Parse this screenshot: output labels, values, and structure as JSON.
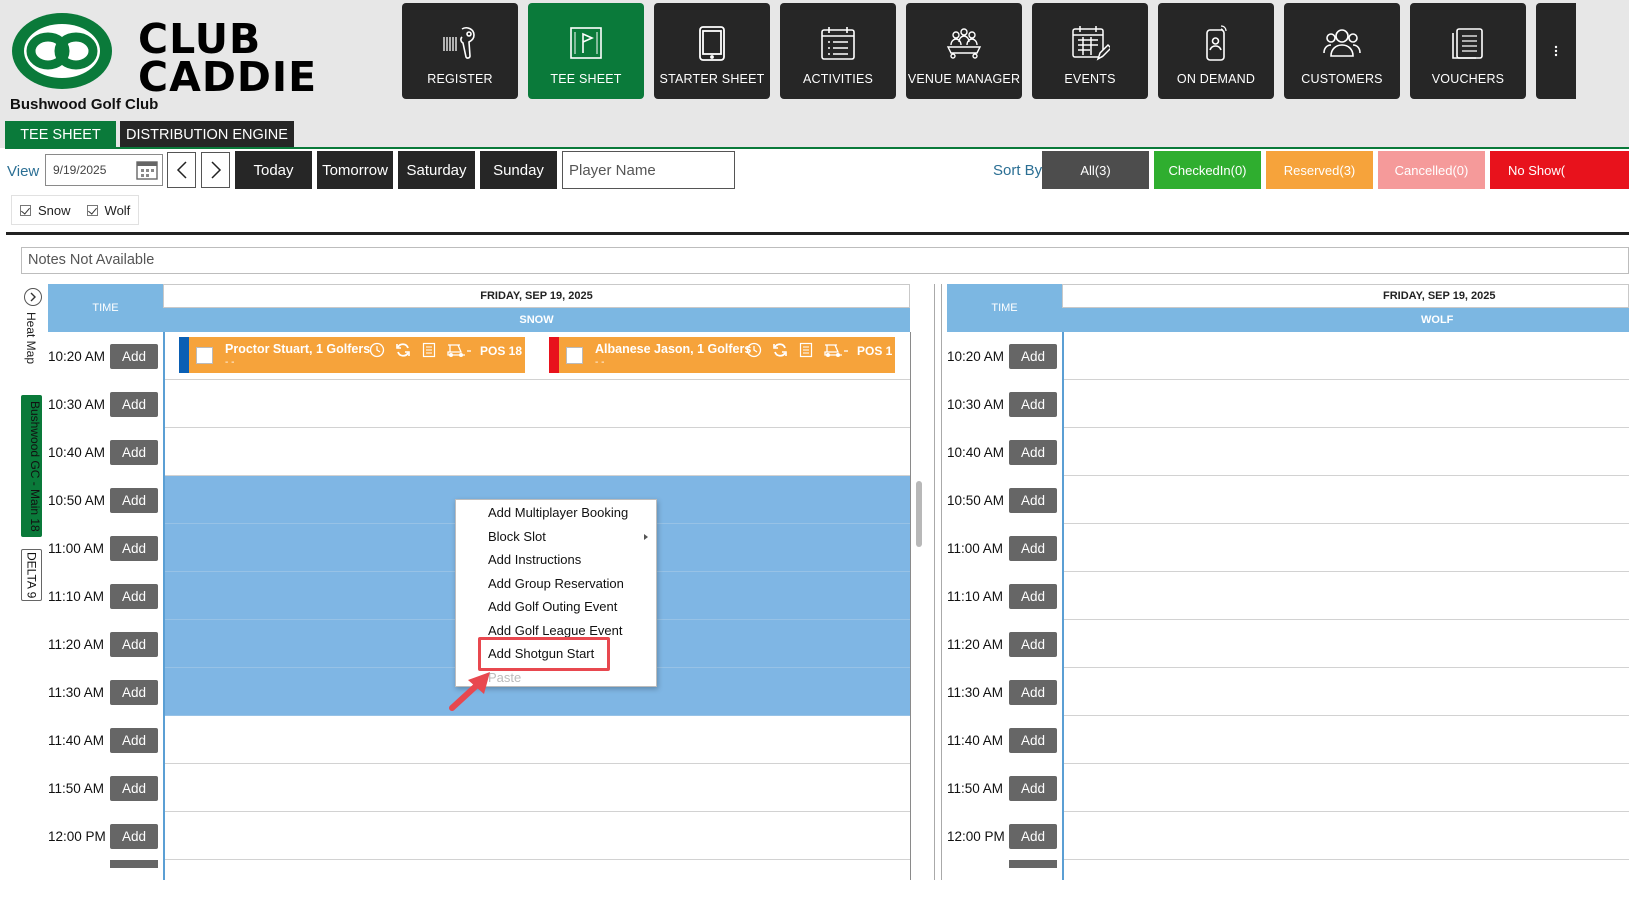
{
  "brand": {
    "logo_line1": "CLUB",
    "logo_line2": "CADDIE",
    "club_name": "Bushwood Golf Club",
    "green": "#0a7a3a"
  },
  "nav": [
    {
      "label": "REGISTER",
      "icon": "barcode-scanner-icon",
      "active": false
    },
    {
      "label": "TEE SHEET",
      "icon": "flag-board-icon",
      "active": true
    },
    {
      "label": "STARTER SHEET",
      "icon": "tablet-icon",
      "active": false
    },
    {
      "label": "ACTIVITIES",
      "icon": "calendar-list-icon",
      "active": false
    },
    {
      "label": "VENUE MANAGER",
      "icon": "meeting-table-icon",
      "active": false
    },
    {
      "label": "EVENTS",
      "icon": "calendar-edit-icon",
      "active": false
    },
    {
      "label": "ON DEMAND",
      "icon": "mobile-signal-icon",
      "active": false
    },
    {
      "label": "CUSTOMERS",
      "icon": "users-icon",
      "active": false
    },
    {
      "label": "VOUCHERS",
      "icon": "voucher-list-icon",
      "active": false
    }
  ],
  "tabs": {
    "tee_sheet": "TEE SHEET",
    "distribution": "DISTRIBUTION ENGINE"
  },
  "toolbar": {
    "view_label": "View",
    "date_value": "9/19/2025",
    "today": "Today",
    "tomorrow": "Tomorrow",
    "saturday": "Saturday",
    "sunday": "Sunday",
    "player_placeholder": "Player Name",
    "sort_label": "Sort By",
    "sort_all": "All(3)",
    "sort_checked": "CheckedIn(0)",
    "sort_reserved": "Reserved(3)",
    "sort_cancelled": "Cancelled(0)",
    "sort_noshow": "No Show(",
    "filter_snow": "Snow",
    "filter_wolf": "Wolf"
  },
  "sort_colors": {
    "all": "#4d4d4d",
    "checked": "#2fae2f",
    "reserved": "#f6a33b",
    "cancelled": "#f59a9a",
    "noshow": "#e8121c"
  },
  "notes": "Notes Not Available",
  "side": {
    "heat_map": "Heat Map",
    "course": "Bushwood GC - Main 18",
    "delta": "DELTA 9"
  },
  "sheets": {
    "time_header": "TIME",
    "date_header": "FRIDAY, SEP 19, 2025",
    "left_course": "SNOW",
    "right_course": "WOLF",
    "add_label": "Add",
    "times": [
      "10:20 AM",
      "10:30 AM",
      "10:40 AM",
      "10:50 AM",
      "11:00 AM",
      "11:10 AM",
      "11:20 AM",
      "11:30 AM",
      "11:40 AM",
      "11:50 AM",
      "12:00 PM"
    ]
  },
  "bookings": [
    {
      "name": "Proctor Stuart, 1 Golfers",
      "sub": "- -",
      "pos": "POS 18",
      "stripe": "#0a5fb4"
    },
    {
      "name": "Albanese Jason, 1 Golfers",
      "sub": "- -",
      "pos": "POS 1",
      "stripe": "#e8121c"
    }
  ],
  "context_menu": [
    {
      "label": "Add Multiplayer Booking",
      "submenu": false,
      "disabled": false
    },
    {
      "label": "Block Slot",
      "submenu": true,
      "disabled": false
    },
    {
      "label": "Add Instructions",
      "submenu": false,
      "disabled": false
    },
    {
      "label": "Add Group Reservation",
      "submenu": false,
      "disabled": false
    },
    {
      "label": "Add Golf Outing Event",
      "submenu": false,
      "disabled": false
    },
    {
      "label": "Add Golf League Event",
      "submenu": false,
      "disabled": false
    },
    {
      "label": "Add Shotgun Start",
      "submenu": false,
      "disabled": false
    },
    {
      "label": "Paste",
      "submenu": false,
      "disabled": true
    }
  ]
}
